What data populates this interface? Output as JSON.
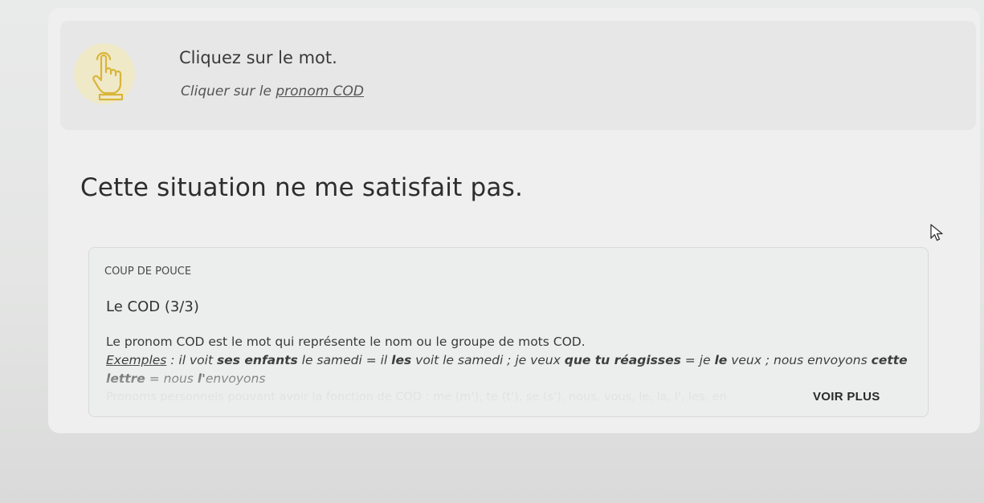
{
  "instruction": {
    "title": "Cliquez sur le mot.",
    "subtitle_prefix": "Cliquer sur le ",
    "subtitle_link": "pronom COD"
  },
  "sentence": {
    "words": [
      "Cette",
      "situation",
      "ne",
      "me",
      "satisfait",
      "pas."
    ]
  },
  "hint": {
    "tag": "COUP DE POUCE",
    "title": "Le COD (3/3)",
    "definition": "Le pronom COD est le mot qui représente le nom ou le groupe de mots COD.",
    "examples_label": "Exemples",
    "ex1_a": " : il voit ",
    "ex1_b": "ses enfants",
    "ex1_c": " le samedi = il ",
    "ex1_d": "les",
    "ex1_e": " voit le samedi ; je veux ",
    "ex2_b": "que tu réagisses",
    "ex2_c": " = je ",
    "ex2_d": "le",
    "ex2_e": " veux ; nous envoyons ",
    "ex3_b": "cette lettre",
    "ex3_c": " = nous ",
    "ex3_d": "l'",
    "ex3_e": "envoyons",
    "faded_line": "Pronoms personnels pouvant avoir la fonction de COD : me (m'), te (t'), se (s'), nous, vous, le, la, l', les, en",
    "see_more": "VOIR PLUS"
  },
  "colors": {
    "background": "#e6e7e6",
    "hand_icon_circle": "#efe9c8",
    "hand_icon_stroke": "#d9b53a"
  },
  "icons": {
    "hand": "tap-hand-icon",
    "cursor": "mouse-pointer-icon"
  }
}
